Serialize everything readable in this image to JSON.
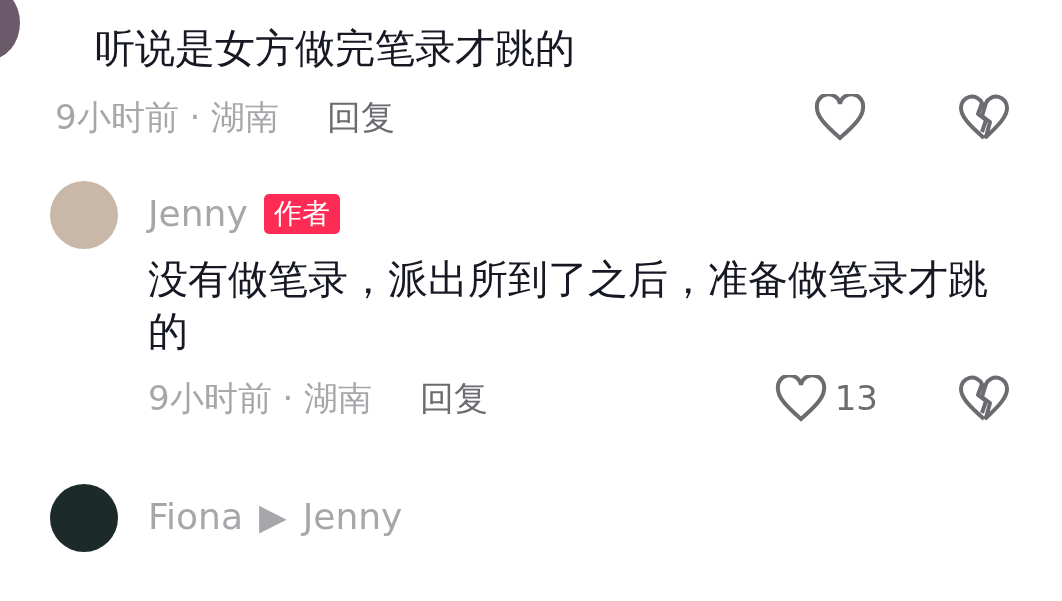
{
  "comments": [
    {
      "text": "听说是女方做完笔录才跳的",
      "meta": "9小时前 · 湖南",
      "reply_label": "回复",
      "replies": [
        {
          "author": "Jenny",
          "badge": "作者",
          "text": "没有做笔录，派出所到了之后，准备做笔录才跳的",
          "meta": "9小时前 · 湖南",
          "reply_label": "回复",
          "like_count": "13"
        },
        {
          "author": "Fiona",
          "arrow": "▶",
          "reply_to": "Jenny"
        }
      ]
    }
  ]
}
